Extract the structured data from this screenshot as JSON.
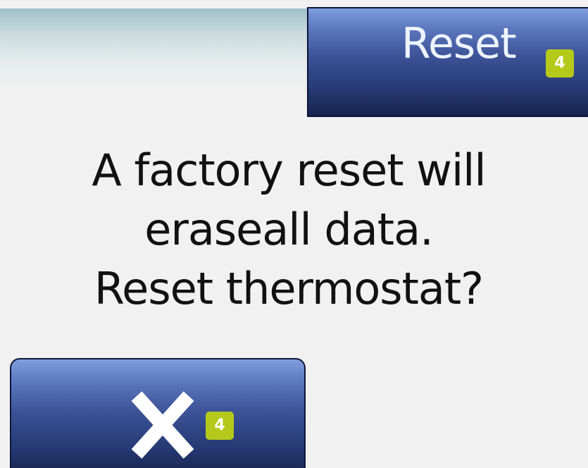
{
  "header": {
    "reset_button": {
      "label": "Reset",
      "badge": "4"
    }
  },
  "dialog": {
    "message_lines": [
      "A factory reset will",
      "eraseall data.",
      "Reset thermostat?"
    ]
  },
  "footer": {
    "cancel_button": {
      "icon": "close-icon",
      "badge": "4"
    }
  },
  "colors": {
    "background": "#f1f1f1",
    "button_top": "#7f9ede",
    "button_bottom": "#16234e",
    "badge": "#b5c91b",
    "text": "#111111"
  }
}
